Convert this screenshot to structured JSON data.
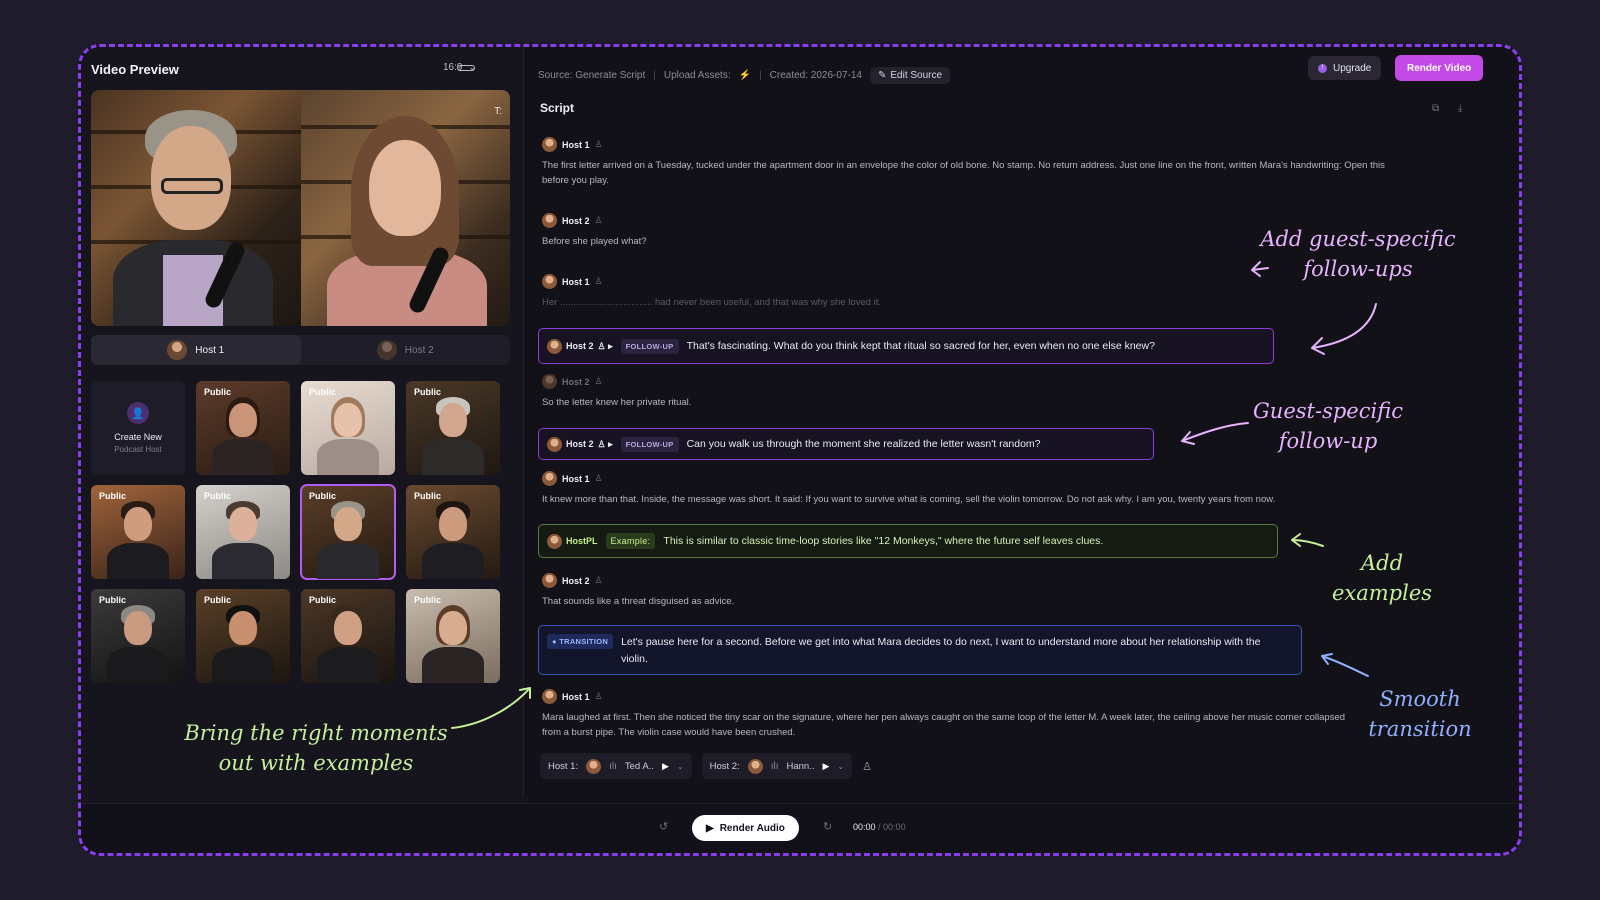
{
  "left_panel": {
    "title": "Video Preview",
    "aspect_ratio": "16:9",
    "host_tabs": [
      {
        "label": "Host 1",
        "active": true
      },
      {
        "label": "Host 2",
        "active": false
      }
    ],
    "create_new": {
      "title": "Create New",
      "subtitle": "Podcast Host"
    },
    "thumb_badge": "Public"
  },
  "topbar": {
    "source": "Source: Generate Script",
    "upload": "Upload Assets:",
    "created": "Created: 2026-07-14",
    "edit_source": "Edit Source",
    "upgrade": "Upgrade",
    "render_video": "Render Video"
  },
  "script": {
    "title": "Script",
    "entries": [
      {
        "speaker": "Host 1",
        "text": "The first letter arrived on a Tuesday, tucked under the apartment door in an envelope the color of old bone. No stamp. No return address. Just one line on the front, written Mara's handwriting: Open this before you play."
      },
      {
        "speaker": "Host 2",
        "text": "Before she played what?"
      },
      {
        "speaker": "Host 1",
        "text": "Her ................................... had never been useful, and that was why she loved it."
      },
      {
        "speaker": "Host 2",
        "tag": "FOLLOW-UP",
        "text": "That's fascinating. What do you think kept that ritual so sacred for her, even when no one else knew?"
      },
      {
        "speaker": "Host 2",
        "text": "So the letter knew her private ritual."
      },
      {
        "speaker": "Host 2",
        "tag": "FOLLOW-UP",
        "text": "Can you walk us through the moment she realized the letter wasn't random?"
      },
      {
        "speaker": "Host 1",
        "text": "It knew more than that. Inside, the message was short. It said: If you want to survive what is coming, sell the violin tomorrow. Do not ask why. I am you, twenty years from now."
      },
      {
        "speaker": "HostPL",
        "tag": "Example:",
        "text": "This is similar to classic time-loop stories like \"12 Monkeys,\" where the future self leaves clues."
      },
      {
        "speaker": "Host 2",
        "text": "That sounds like a threat disguised as advice."
      },
      {
        "tag": "TRANSITION",
        "text": "Let's pause here for a second. Before we get into what Mara decides to do next, I want to understand more about her relationship with the violin."
      },
      {
        "speaker": "Host 1",
        "text": "Mara laughed at first. Then she noticed the tiny scar on the signature, where her pen always caught on the same loop of the letter M. A week later, the ceiling above her music corner collapsed from a burst pipe. The violin case would have been crushed."
      }
    ]
  },
  "voices": [
    {
      "label": "Host 1:",
      "voice": "Ted A.."
    },
    {
      "label": "Host 2:",
      "voice": "Hann.."
    }
  ],
  "player": {
    "render_audio": "Render Audio",
    "current_time": "00:00",
    "total_time": "/ 00:00"
  },
  "annotations": {
    "add_followups": [
      "Add guest-specific",
      "follow-ups"
    ],
    "guest_followup": [
      "Guest-specific",
      "follow-up"
    ],
    "add_examples": "Add examples",
    "smooth_transition": "Smooth transition",
    "bring_moments": [
      "Bring the right moments",
      "out with examples"
    ]
  },
  "colors": {
    "frame_border": "#8b3df0",
    "render_video": "#c44ae8",
    "followup_border": "#8a3fd9",
    "example_border": "#5b7a3f",
    "transition_border": "#3b56b4",
    "annotation_pink": "#e7b3ff",
    "annotation_green": "#c6ef9a",
    "annotation_blue": "#8fb0ff"
  }
}
